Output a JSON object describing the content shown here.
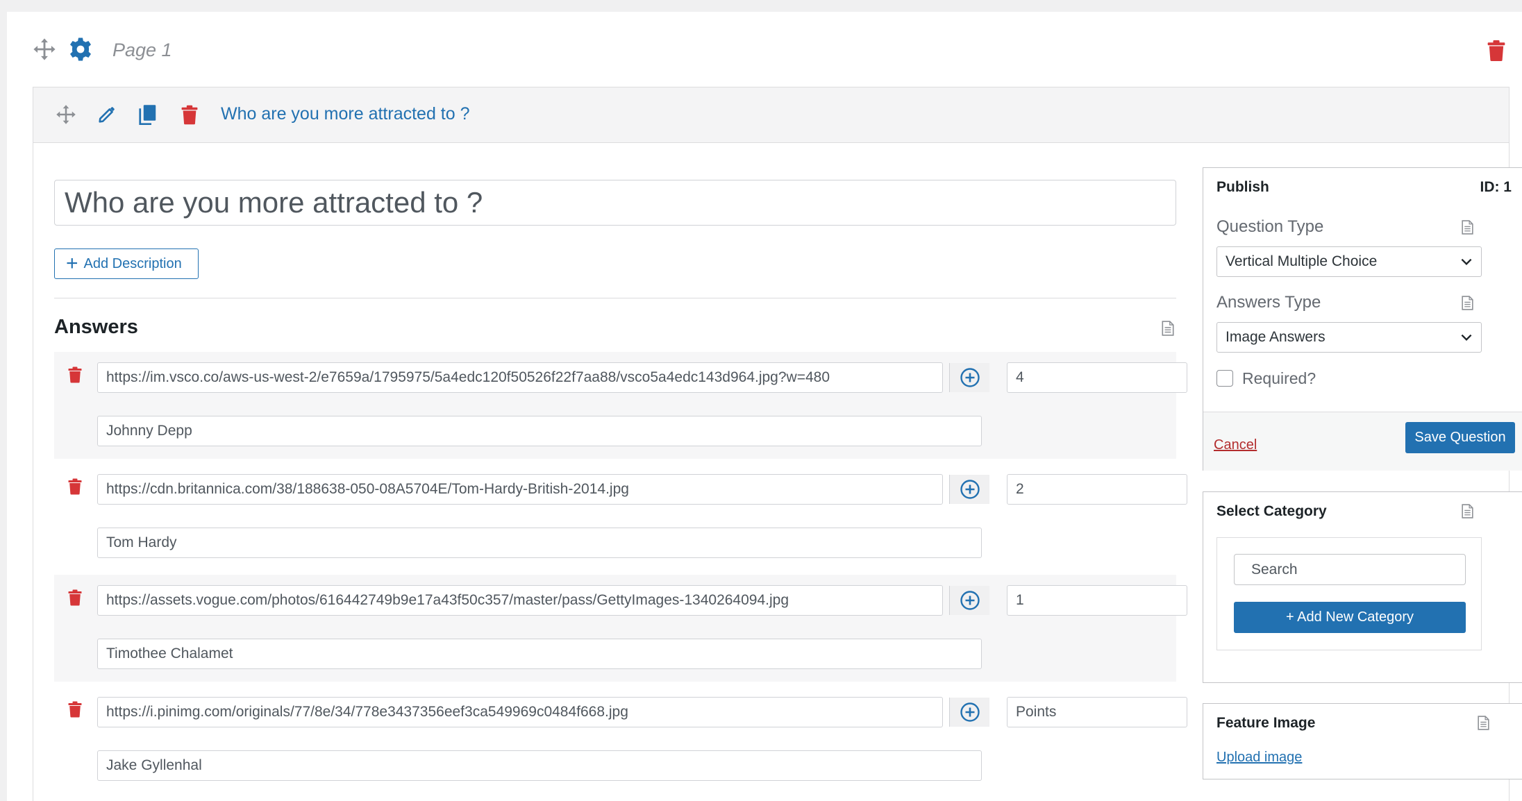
{
  "page": {
    "title": "Page 1"
  },
  "question": {
    "header_title": "Who are you more attracted to ?",
    "title_value": "Who are you more attracted to ?",
    "add_description_label": "Add Description",
    "answers_heading": "Answers",
    "answers": [
      {
        "url": "https://im.vsco.co/aws-us-west-2/e7659a/1795975/5a4edc120f50526f22f7aa88/vsco5a4edc143d964.jpg?w=480",
        "points": "4",
        "points_placeholder": "Points",
        "name": "Johnny Depp"
      },
      {
        "url": "https://cdn.britannica.com/38/188638-050-08A5704E/Tom-Hardy-British-2014.jpg",
        "points": "2",
        "points_placeholder": "Points",
        "name": "Tom Hardy"
      },
      {
        "url": "https://assets.vogue.com/photos/616442749b9e17a43f50c357/master/pass/GettyImages-1340264094.jpg",
        "points": "1",
        "points_placeholder": "Points",
        "name": "Timothee Chalamet"
      },
      {
        "url": "https://i.pinimg.com/originals/77/8e/34/778e3437356eef3ca549969c0484f668.jpg",
        "points": "",
        "points_placeholder": "Points",
        "name": "Jake Gyllenhal"
      }
    ]
  },
  "publish": {
    "heading": "Publish",
    "id_label": "ID: 1",
    "question_type_label": "Question Type",
    "question_type_value": "Vertical Multiple Choice",
    "answers_type_label": "Answers Type",
    "answers_type_value": "Image Answers",
    "required_label": "Required?",
    "required_checked": false,
    "cancel_label": "Cancel",
    "save_label": "Save Question"
  },
  "category": {
    "heading": "Select Category",
    "search_placeholder": "Search",
    "add_label": "+ Add New Category"
  },
  "feature_image": {
    "heading": "Feature Image",
    "upload_label": "Upload image"
  },
  "icons": {
    "move": "move-icon",
    "settings": "gear-icon",
    "delete": "trash-icon",
    "edit": "pencil-icon",
    "duplicate": "copy-icon",
    "add_image": "plus-circle-icon",
    "help": "document-icon",
    "dropdown": "chevron-down-icon"
  },
  "colors": {
    "accent": "#2271b1",
    "danger": "#d63638",
    "gear": "#2271b1",
    "muted": "#8c8f94"
  }
}
